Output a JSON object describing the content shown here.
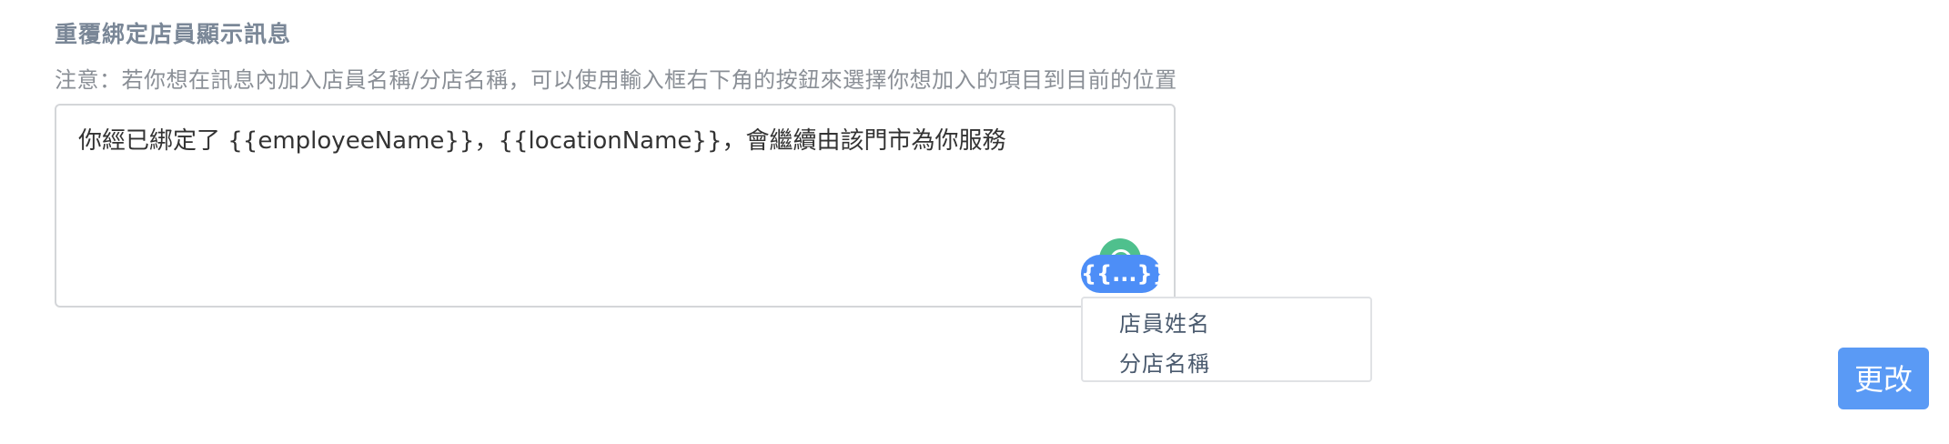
{
  "section": {
    "title": "重覆綁定店員顯示訊息",
    "hint": "注意：若你想在訊息內加入店員名稱/分店名稱，可以使用輸入框右下角的按鈕來選擇你想加入的項目到目前的位置"
  },
  "editor": {
    "value": "你經已綁定了 {{employeeName}}，{{locationName}}，會繼續由該門市為你服務"
  },
  "variable_picker": {
    "button_label": "{{...}}",
    "options": [
      "店員姓名",
      "分店名稱"
    ]
  },
  "actions": {
    "submit_label": "更改"
  },
  "colors": {
    "accent": "#4d8ef7",
    "submit": "#5a9af5",
    "indicator": "#4fc08d"
  }
}
